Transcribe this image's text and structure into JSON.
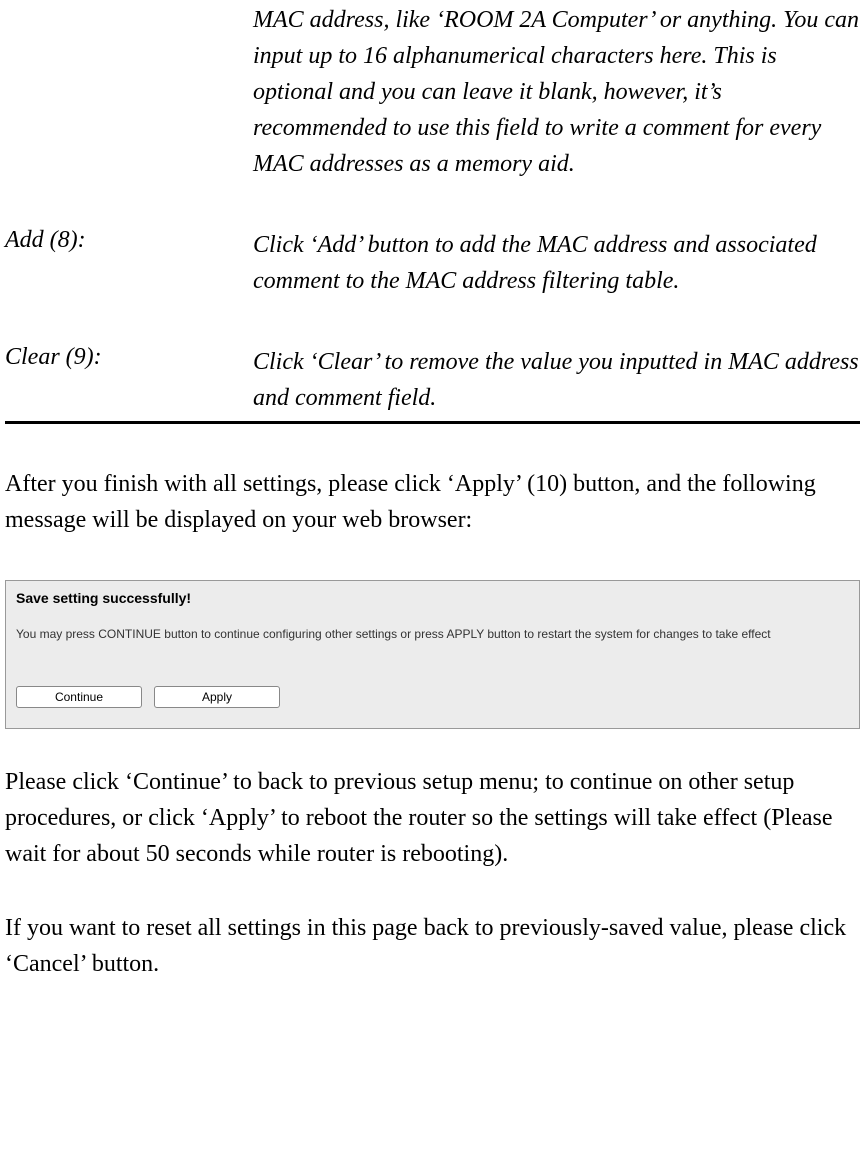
{
  "defs": {
    "commentTail": "MAC address, like ‘ROOM 2A Computer’ or anything. You can input up to 16 alphanumerical characters here. This is optional and you can leave it blank, however, it’s recommended to use this field to write a comment for every MAC addresses as a memory aid.",
    "addLabel": "Add (8):",
    "addDesc": "Click ‘Add’ button to add the MAC address and associated comment to the MAC address filtering table.",
    "clearLabel": "Clear (9):",
    "clearDesc": "Click ‘Clear’ to remove the value you inputted in MAC address and comment field."
  },
  "para1": "After you finish with all settings, please click ‘Apply’ (10) button, and the following message will be displayed on your web browser:",
  "screenshot": {
    "title": "Save setting successfully!",
    "msg": "You may press CONTINUE button to continue configuring other settings or press APPLY button to restart the system for changes to take effect",
    "continueBtn": "Continue",
    "applyBtn": "Apply"
  },
  "para2": "Please click ‘Continue’ to back to previous setup menu; to continue on other setup procedures, or click ‘Apply’ to reboot the router so the settings will take effect (Please wait for about 50 seconds while router is rebooting).",
  "para3": "If you want to reset all settings in this page back to previously-saved value, please click ‘Cancel’ button."
}
